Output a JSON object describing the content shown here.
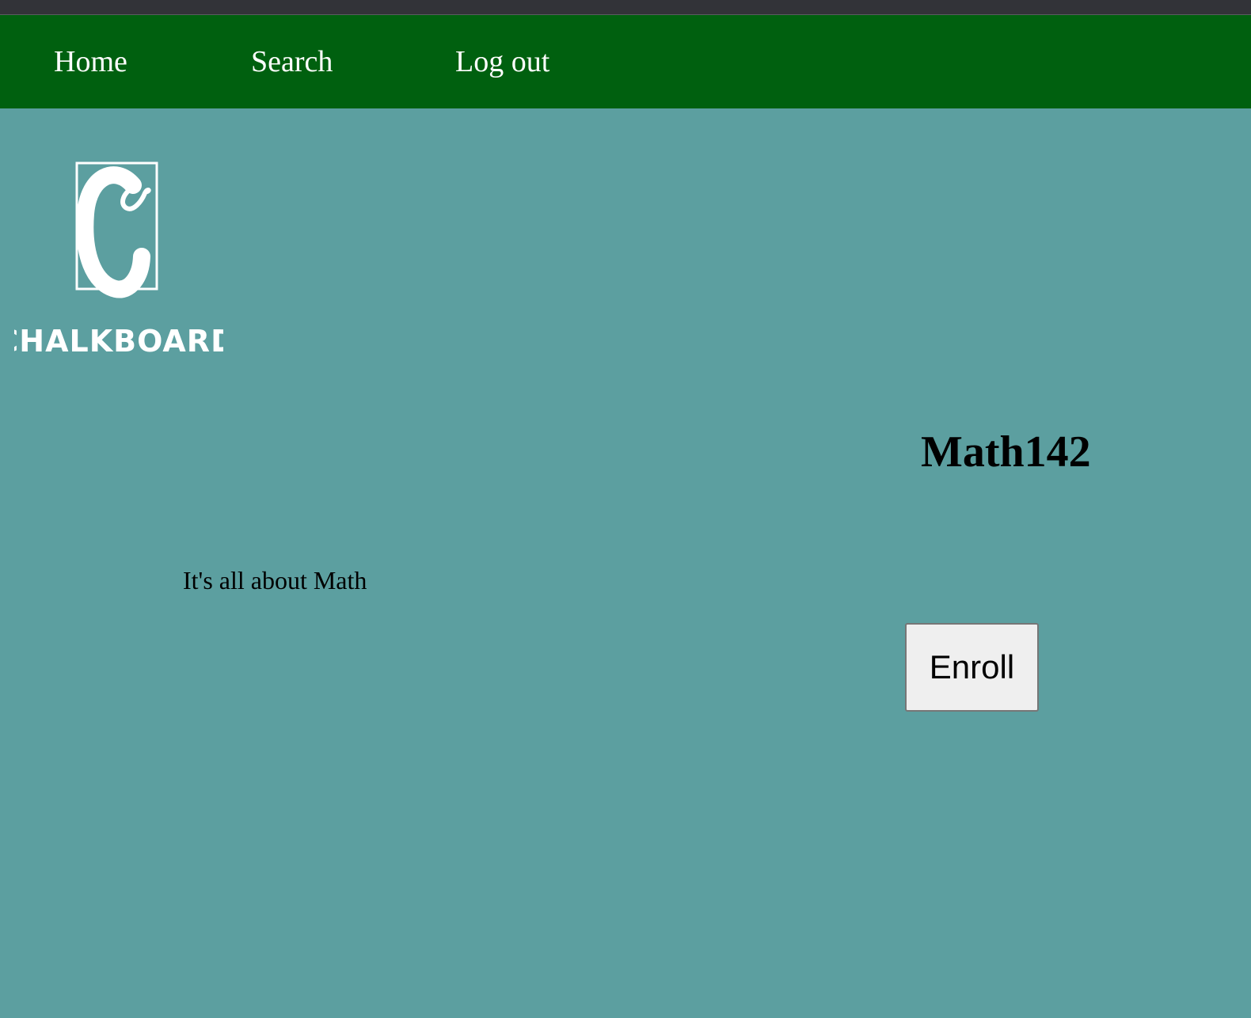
{
  "nav": {
    "home_label": "Home",
    "search_label": "Search",
    "logout_label": "Log out"
  },
  "logo": {
    "letter": "C",
    "wordmark": "CHALKBOARD"
  },
  "course": {
    "title": "Math142",
    "description": "It's all about Math",
    "enroll_label": "Enroll"
  },
  "colors": {
    "page_background": "#5c9fa0",
    "navbar": "#00600f",
    "top_strip": "#323338",
    "nav_text": "#ffffff",
    "button_background": "#efefef"
  }
}
